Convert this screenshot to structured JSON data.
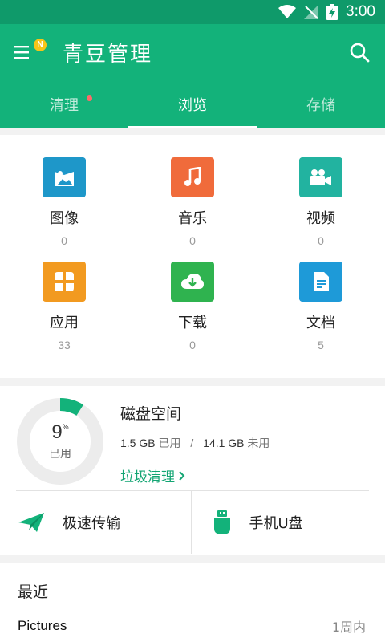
{
  "status_bar": {
    "time": "3:00"
  },
  "header": {
    "title": "青豆管理",
    "menu_badge": "N"
  },
  "tabs": [
    {
      "label": "清理",
      "has_dot": true
    },
    {
      "label": "浏览",
      "active": true
    },
    {
      "label": "存储"
    }
  ],
  "categories": [
    {
      "label": "图像",
      "count": "0",
      "icon": "image-icon",
      "color": "#1e97c9"
    },
    {
      "label": "音乐",
      "count": "0",
      "icon": "music-icon",
      "color": "#f06b3b"
    },
    {
      "label": "视频",
      "count": "0",
      "icon": "video-icon",
      "color": "#22b3a0"
    },
    {
      "label": "应用",
      "count": "33",
      "icon": "apps-icon",
      "color": "#f29a20"
    },
    {
      "label": "下载",
      "count": "0",
      "icon": "download-icon",
      "color": "#2fb34f"
    },
    {
      "label": "文档",
      "count": "5",
      "icon": "document-icon",
      "color": "#1e9ad8"
    }
  ],
  "disk": {
    "title": "磁盘空间",
    "percent": "9",
    "percent_sign": "%",
    "percent_value": 0.09,
    "used_label": "已用",
    "used_amount": "1.5 GB",
    "used_text": "已用",
    "separator": "/",
    "free_amount": "14.1 GB",
    "free_text": "未用",
    "cleanup_link": "垃圾清理"
  },
  "quick_actions": [
    {
      "label": "极速传输",
      "icon": "paper-plane-icon"
    },
    {
      "label": "手机U盘",
      "icon": "usb-drive-icon"
    }
  ],
  "recent": {
    "title": "最近",
    "items": [
      {
        "name": "Pictures",
        "time": "1周内"
      }
    ]
  },
  "colors": {
    "primary": "#13b27a",
    "status_bar": "#0f9a6a",
    "accent_text": "#13a573"
  }
}
